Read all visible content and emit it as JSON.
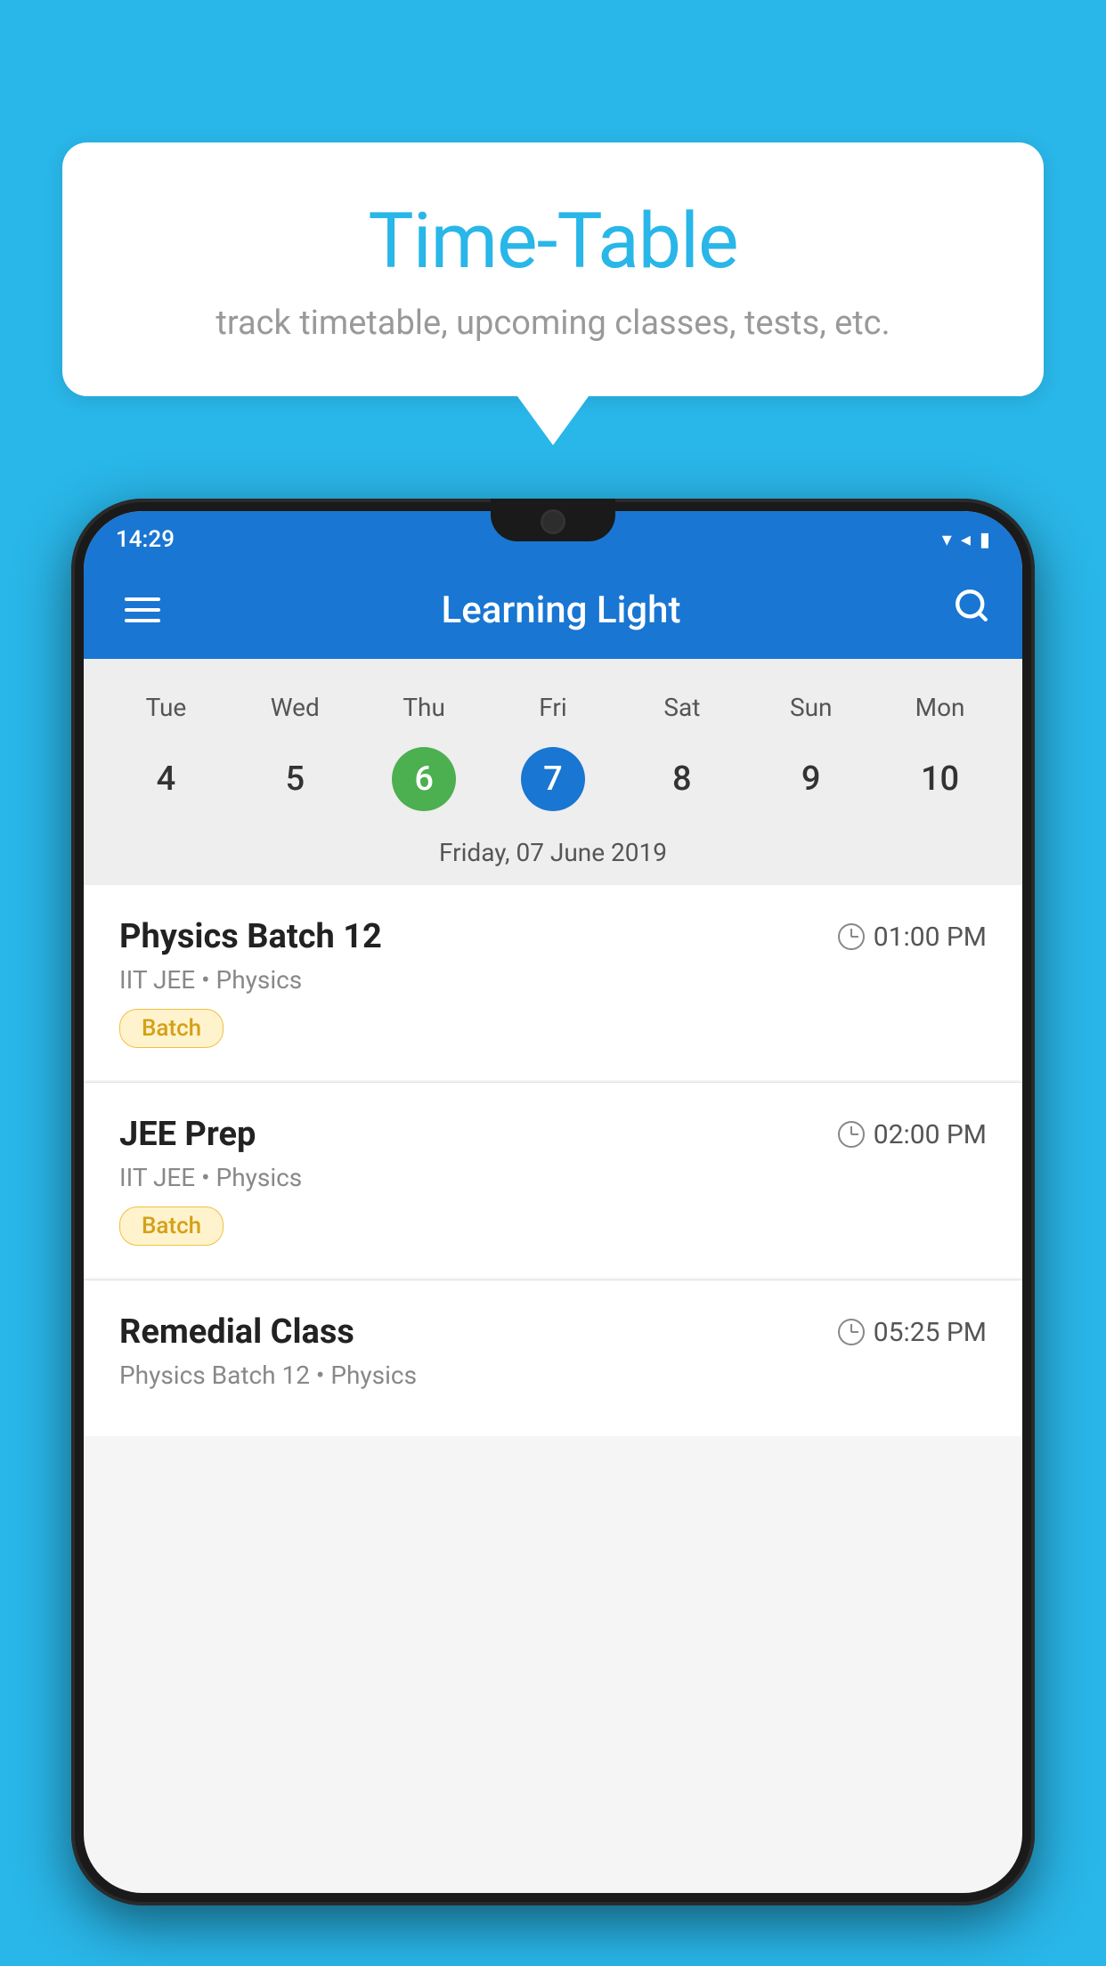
{
  "background_color": "#29b6e8",
  "speech_bubble": {
    "title": "Time-Table",
    "subtitle": "track timetable, upcoming classes, tests, etc."
  },
  "phone": {
    "status_bar": {
      "time": "14:29",
      "icons": [
        "wifi",
        "signal",
        "battery"
      ]
    },
    "app_bar": {
      "title": "Learning Light",
      "menu_icon": "menu-icon",
      "search_icon": "search-icon"
    },
    "calendar": {
      "days": [
        "Tue",
        "Wed",
        "Thu",
        "Fri",
        "Sat",
        "Sun",
        "Mon"
      ],
      "dates": [
        "4",
        "5",
        "6",
        "7",
        "8",
        "9",
        "10"
      ],
      "today_index": 2,
      "selected_index": 3,
      "selected_date_label": "Friday, 07 June 2019"
    },
    "schedule": [
      {
        "title": "Physics Batch 12",
        "time": "01:00 PM",
        "subtitle": "IIT JEE • Physics",
        "tag": "Batch"
      },
      {
        "title": "JEE Prep",
        "time": "02:00 PM",
        "subtitle": "IIT JEE • Physics",
        "tag": "Batch"
      },
      {
        "title": "Remedial Class",
        "time": "05:25 PM",
        "subtitle": "Physics Batch 12 • Physics",
        "tag": ""
      }
    ]
  }
}
